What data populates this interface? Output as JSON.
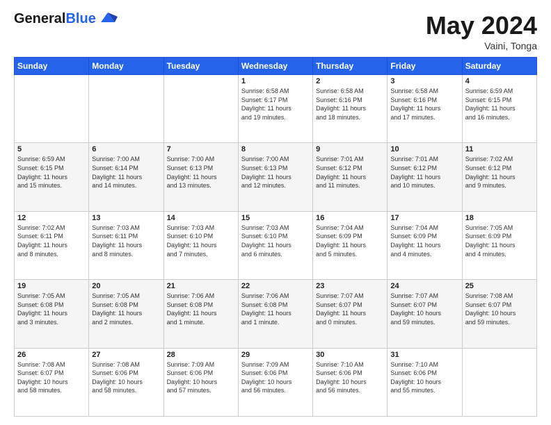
{
  "header": {
    "logo_line1": "General",
    "logo_line2": "Blue",
    "month_year": "May 2024",
    "location": "Vaini, Tonga"
  },
  "weekdays": [
    "Sunday",
    "Monday",
    "Tuesday",
    "Wednesday",
    "Thursday",
    "Friday",
    "Saturday"
  ],
  "weeks": [
    [
      {
        "day": "",
        "info": ""
      },
      {
        "day": "",
        "info": ""
      },
      {
        "day": "",
        "info": ""
      },
      {
        "day": "1",
        "info": "Sunrise: 6:58 AM\nSunset: 6:17 PM\nDaylight: 11 hours\nand 19 minutes."
      },
      {
        "day": "2",
        "info": "Sunrise: 6:58 AM\nSunset: 6:16 PM\nDaylight: 11 hours\nand 18 minutes."
      },
      {
        "day": "3",
        "info": "Sunrise: 6:58 AM\nSunset: 6:16 PM\nDaylight: 11 hours\nand 17 minutes."
      },
      {
        "day": "4",
        "info": "Sunrise: 6:59 AM\nSunset: 6:15 PM\nDaylight: 11 hours\nand 16 minutes."
      }
    ],
    [
      {
        "day": "5",
        "info": "Sunrise: 6:59 AM\nSunset: 6:15 PM\nDaylight: 11 hours\nand 15 minutes."
      },
      {
        "day": "6",
        "info": "Sunrise: 7:00 AM\nSunset: 6:14 PM\nDaylight: 11 hours\nand 14 minutes."
      },
      {
        "day": "7",
        "info": "Sunrise: 7:00 AM\nSunset: 6:13 PM\nDaylight: 11 hours\nand 13 minutes."
      },
      {
        "day": "8",
        "info": "Sunrise: 7:00 AM\nSunset: 6:13 PM\nDaylight: 11 hours\nand 12 minutes."
      },
      {
        "day": "9",
        "info": "Sunrise: 7:01 AM\nSunset: 6:12 PM\nDaylight: 11 hours\nand 11 minutes."
      },
      {
        "day": "10",
        "info": "Sunrise: 7:01 AM\nSunset: 6:12 PM\nDaylight: 11 hours\nand 10 minutes."
      },
      {
        "day": "11",
        "info": "Sunrise: 7:02 AM\nSunset: 6:12 PM\nDaylight: 11 hours\nand 9 minutes."
      }
    ],
    [
      {
        "day": "12",
        "info": "Sunrise: 7:02 AM\nSunset: 6:11 PM\nDaylight: 11 hours\nand 8 minutes."
      },
      {
        "day": "13",
        "info": "Sunrise: 7:03 AM\nSunset: 6:11 PM\nDaylight: 11 hours\nand 8 minutes."
      },
      {
        "day": "14",
        "info": "Sunrise: 7:03 AM\nSunset: 6:10 PM\nDaylight: 11 hours\nand 7 minutes."
      },
      {
        "day": "15",
        "info": "Sunrise: 7:03 AM\nSunset: 6:10 PM\nDaylight: 11 hours\nand 6 minutes."
      },
      {
        "day": "16",
        "info": "Sunrise: 7:04 AM\nSunset: 6:09 PM\nDaylight: 11 hours\nand 5 minutes."
      },
      {
        "day": "17",
        "info": "Sunrise: 7:04 AM\nSunset: 6:09 PM\nDaylight: 11 hours\nand 4 minutes."
      },
      {
        "day": "18",
        "info": "Sunrise: 7:05 AM\nSunset: 6:09 PM\nDaylight: 11 hours\nand 4 minutes."
      }
    ],
    [
      {
        "day": "19",
        "info": "Sunrise: 7:05 AM\nSunset: 6:08 PM\nDaylight: 11 hours\nand 3 minutes."
      },
      {
        "day": "20",
        "info": "Sunrise: 7:05 AM\nSunset: 6:08 PM\nDaylight: 11 hours\nand 2 minutes."
      },
      {
        "day": "21",
        "info": "Sunrise: 7:06 AM\nSunset: 6:08 PM\nDaylight: 11 hours\nand 1 minute."
      },
      {
        "day": "22",
        "info": "Sunrise: 7:06 AM\nSunset: 6:08 PM\nDaylight: 11 hours\nand 1 minute."
      },
      {
        "day": "23",
        "info": "Sunrise: 7:07 AM\nSunset: 6:07 PM\nDaylight: 11 hours\nand 0 minutes."
      },
      {
        "day": "24",
        "info": "Sunrise: 7:07 AM\nSunset: 6:07 PM\nDaylight: 10 hours\nand 59 minutes."
      },
      {
        "day": "25",
        "info": "Sunrise: 7:08 AM\nSunset: 6:07 PM\nDaylight: 10 hours\nand 59 minutes."
      }
    ],
    [
      {
        "day": "26",
        "info": "Sunrise: 7:08 AM\nSunset: 6:07 PM\nDaylight: 10 hours\nand 58 minutes."
      },
      {
        "day": "27",
        "info": "Sunrise: 7:08 AM\nSunset: 6:06 PM\nDaylight: 10 hours\nand 58 minutes."
      },
      {
        "day": "28",
        "info": "Sunrise: 7:09 AM\nSunset: 6:06 PM\nDaylight: 10 hours\nand 57 minutes."
      },
      {
        "day": "29",
        "info": "Sunrise: 7:09 AM\nSunset: 6:06 PM\nDaylight: 10 hours\nand 56 minutes."
      },
      {
        "day": "30",
        "info": "Sunrise: 7:10 AM\nSunset: 6:06 PM\nDaylight: 10 hours\nand 56 minutes."
      },
      {
        "day": "31",
        "info": "Sunrise: 7:10 AM\nSunset: 6:06 PM\nDaylight: 10 hours\nand 55 minutes."
      },
      {
        "day": "",
        "info": ""
      }
    ]
  ]
}
